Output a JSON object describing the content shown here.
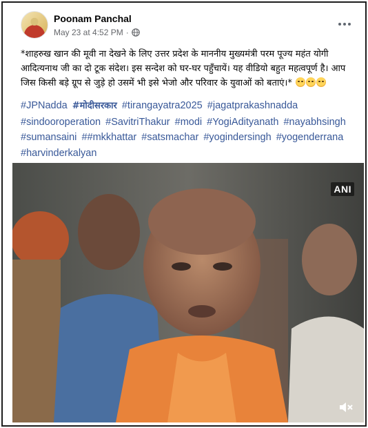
{
  "post": {
    "author": "Poonam Panchal",
    "timestamp": "May 23 at 4:52 PM",
    "separator": "·",
    "audience_icon": "globe-icon",
    "more_icon": "more-options-icon",
    "text": "*शाहरुख खान की  मूवी ना देखने के लिए उत्तर प्रदेश के माननीय मुख्यमंत्री परम पूज्य महंत योगी आदित्यनाथ जी का दो टूक संदेश। इस सन्देश को घर-घर पहुँचायें। यह वीडियो बहुत महत्वपूर्ण है। आप जिस किसी बड़े ग्रूप से जुड़े हो उसमें भी इसे भेजो और परिवार के युवाओं को बताएं।* ",
    "emojis": [
      "rolling-eyes-emoji",
      "rolling-eyes-emoji",
      "rolling-eyes-emoji"
    ],
    "hashtags": [
      {
        "text": "#JPNadda",
        "bold": false
      },
      {
        "text": "#मोदीसरकार",
        "bold": true
      },
      {
        "text": "#tirangayatra2025",
        "bold": false
      },
      {
        "text": "#jagatprakashnadda",
        "bold": false
      },
      {
        "text": "#sindooroperation",
        "bold": false
      },
      {
        "text": "#SavitriThakur",
        "bold": false
      },
      {
        "text": "#modi",
        "bold": false
      },
      {
        "text": "#YogiAdityanath",
        "bold": false
      },
      {
        "text": "#nayabhsingh",
        "bold": false
      },
      {
        "text": "#sumansaini",
        "bold": false
      },
      {
        "text": "##mkkhattar",
        "bold": false
      },
      {
        "text": "#satsmachar",
        "bold": false
      },
      {
        "text": "#yogindersingh",
        "bold": false
      },
      {
        "text": "#yogenderrana",
        "bold": false
      },
      {
        "text": "#harvinderkalyan",
        "bold": false
      }
    ],
    "video": {
      "watermark": "ANI",
      "mute_icon": "speaker-muted-icon"
    }
  },
  "colors": {
    "link": "#385898",
    "meta": "#65676b",
    "saffron": "#e8833a"
  }
}
